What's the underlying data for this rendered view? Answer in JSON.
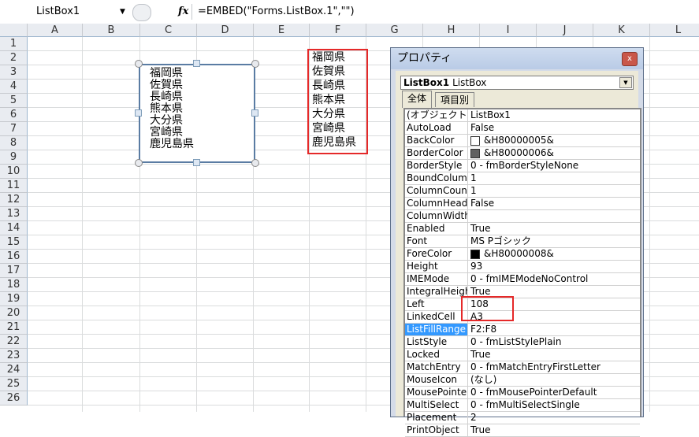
{
  "formula_bar": {
    "name_box": "ListBox1",
    "fx": "fx",
    "formula": "=EMBED(\"Forms.ListBox.1\",\"\")"
  },
  "columns": [
    "A",
    "B",
    "C",
    "D",
    "E",
    "F",
    "G",
    "H",
    "I",
    "J",
    "K",
    "L"
  ],
  "rows": [
    "1",
    "2",
    "3",
    "4",
    "5",
    "6",
    "7",
    "8",
    "9",
    "10",
    "11",
    "12",
    "13",
    "14",
    "15",
    "16",
    "17",
    "18",
    "19",
    "20",
    "21",
    "22",
    "23",
    "24",
    "25",
    "26"
  ],
  "listbox_items": [
    "福岡県",
    "佐賀県",
    "長崎県",
    "熊本県",
    "大分県",
    "宮崎県",
    "鹿児島県"
  ],
  "cells_F": [
    "福岡県",
    "佐賀県",
    "長崎県",
    "熊本県",
    "大分県",
    "宮崎県",
    "鹿児島県"
  ],
  "properties": {
    "title": "プロパティ",
    "close": "x",
    "object_name": "ListBox1",
    "object_type": "ListBox",
    "tabs": [
      "全体",
      "項目別"
    ],
    "rows": [
      {
        "name": "(オブジェクト名)",
        "value": "ListBox1"
      },
      {
        "name": "AutoLoad",
        "value": "False"
      },
      {
        "name": "BackColor",
        "value": "&H80000005&",
        "swatch": "#ffffff"
      },
      {
        "name": "BorderColor",
        "value": "&H80000006&",
        "swatch": "#606060"
      },
      {
        "name": "BorderStyle",
        "value": "0 - fmBorderStyleNone"
      },
      {
        "name": "BoundColumn",
        "value": "1"
      },
      {
        "name": "ColumnCount",
        "value": "1"
      },
      {
        "name": "ColumnHeads",
        "value": "False"
      },
      {
        "name": "ColumnWidths",
        "value": ""
      },
      {
        "name": "Enabled",
        "value": "True"
      },
      {
        "name": "Font",
        "value": "MS Pゴシック"
      },
      {
        "name": "ForeColor",
        "value": "&H80000008&",
        "swatch": "#000000"
      },
      {
        "name": "Height",
        "value": "93"
      },
      {
        "name": "IMEMode",
        "value": "0 - fmIMEModeNoControl"
      },
      {
        "name": "IntegralHeight",
        "value": "True"
      },
      {
        "name": "Left",
        "value": "108"
      },
      {
        "name": "LinkedCell",
        "value": "A3"
      },
      {
        "name": "ListFillRange",
        "value": "F2:F8",
        "selected": true
      },
      {
        "name": "ListStyle",
        "value": "0 - fmListStylePlain"
      },
      {
        "name": "Locked",
        "value": "True"
      },
      {
        "name": "MatchEntry",
        "value": "0 - fmMatchEntryFirstLetter"
      },
      {
        "name": "MouseIcon",
        "value": "(なし)"
      },
      {
        "name": "MousePointer",
        "value": "0 - fmMousePointerDefault"
      },
      {
        "name": "MultiSelect",
        "value": "0 - fmMultiSelectSingle"
      },
      {
        "name": "Placement",
        "value": "2"
      },
      {
        "name": "PrintObject",
        "value": "True"
      }
    ]
  },
  "highlight_color": "#e52929"
}
